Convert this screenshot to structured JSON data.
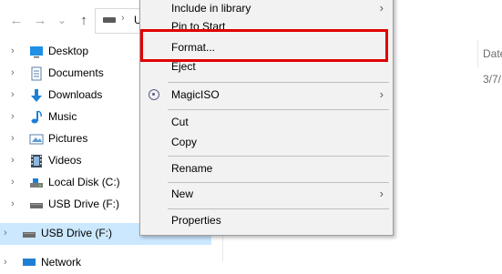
{
  "toolbar": {
    "back_icon": "←",
    "forward_icon": "→",
    "recent_icon": "⌄",
    "up_icon": "↑",
    "address_text": "U",
    "address_chevron": "›"
  },
  "sidebar": {
    "items": [
      {
        "label": "Desktop",
        "icon": "desktop-icon"
      },
      {
        "label": "Documents",
        "icon": "documents-icon"
      },
      {
        "label": "Downloads",
        "icon": "downloads-icon"
      },
      {
        "label": "Music",
        "icon": "music-icon"
      },
      {
        "label": "Pictures",
        "icon": "pictures-icon"
      },
      {
        "label": "Videos",
        "icon": "videos-icon"
      },
      {
        "label": "Local Disk (C:)",
        "icon": "local-disk-icon"
      },
      {
        "label": "USB Drive (F:)",
        "icon": "usb-drive-icon"
      },
      {
        "label": "USB Drive (F:)",
        "icon": "usb-drive-icon",
        "selected": true
      },
      {
        "label": "Network",
        "icon": "network-icon"
      }
    ]
  },
  "content": {
    "date_header": "Date",
    "row_date": "3/7/"
  },
  "context_menu": {
    "items": {
      "include_in_library": "Include in library",
      "pin_to_start": "Pin to Start",
      "format": "Format...",
      "eject": "Eject",
      "magiciso": "MagicISO",
      "cut": "Cut",
      "copy": "Copy",
      "rename": "Rename",
      "new": "New",
      "properties": "Properties"
    },
    "submenu_arrow": "›"
  },
  "colors": {
    "selection": "#cce8ff",
    "menu_bg": "#f2f2f2",
    "highlight_border": "#e00000"
  }
}
